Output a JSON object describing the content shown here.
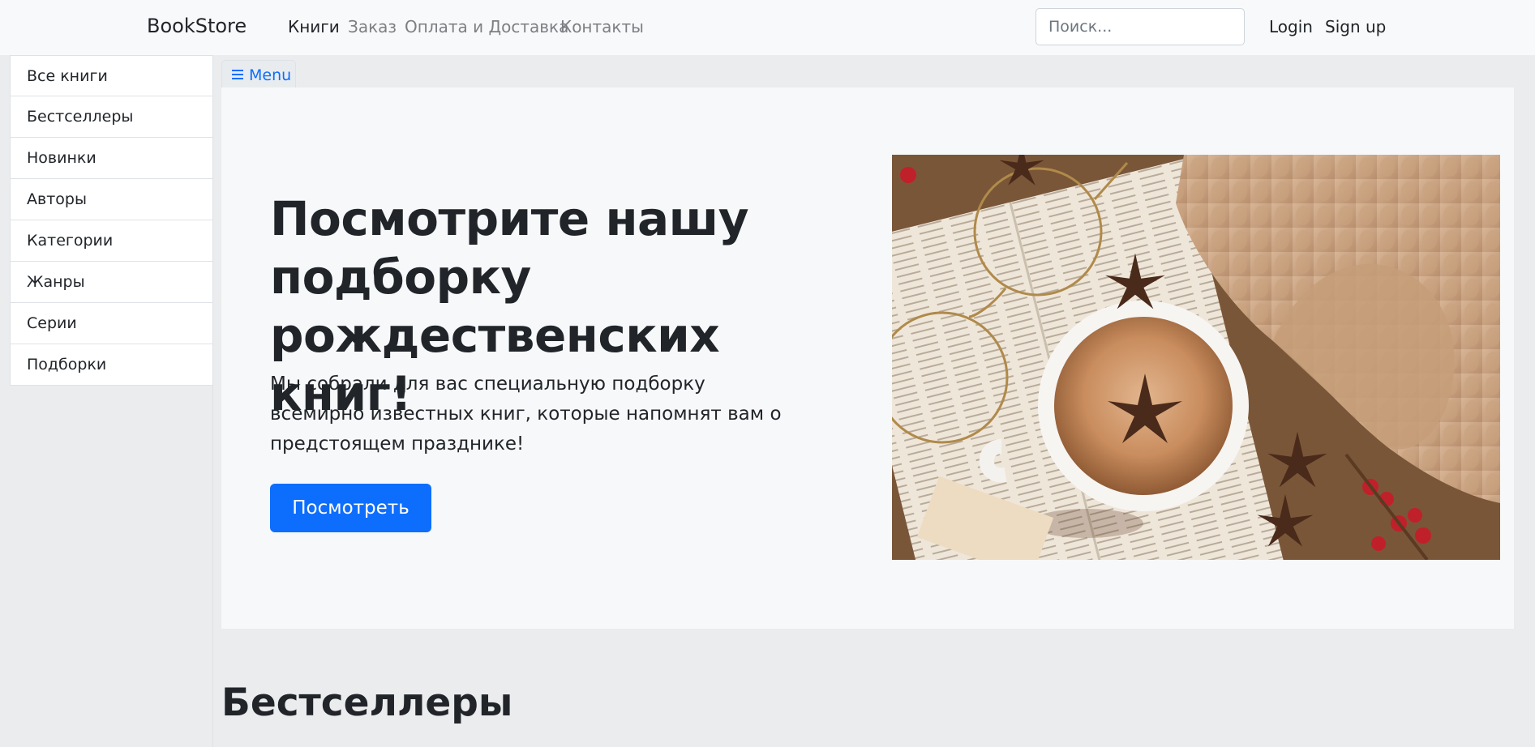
{
  "navbar": {
    "brand": "BookStore",
    "links": [
      "Книги",
      "Заказ",
      "Оплата и Доставка",
      "Контакты"
    ],
    "search_placeholder": "Поиск...",
    "login": "Login",
    "signup": "Sign up"
  },
  "sidebar": {
    "items": [
      "Все книги",
      "Бестселлеры",
      "Новинки",
      "Авторы",
      "Категории",
      "Жанры",
      "Серии",
      "Подборки"
    ]
  },
  "menu_button": {
    "label": "Menu",
    "icon": "hamburger-icon"
  },
  "hero": {
    "title": "Посмотрите нашу подборку рождественских книг!",
    "lead": "Мы собрали для вас специальную подборку всемирно известных книг, которые напомнят вам о предстоящем празднике!",
    "button": "Посмотреть",
    "image": "christmas-cocoa-books-photo"
  },
  "section": {
    "title": "Бестселлеры"
  },
  "colors": {
    "accent": "#0d6efd",
    "navbar_bg": "#f8f9fa",
    "page_bg": "#ebecee"
  }
}
